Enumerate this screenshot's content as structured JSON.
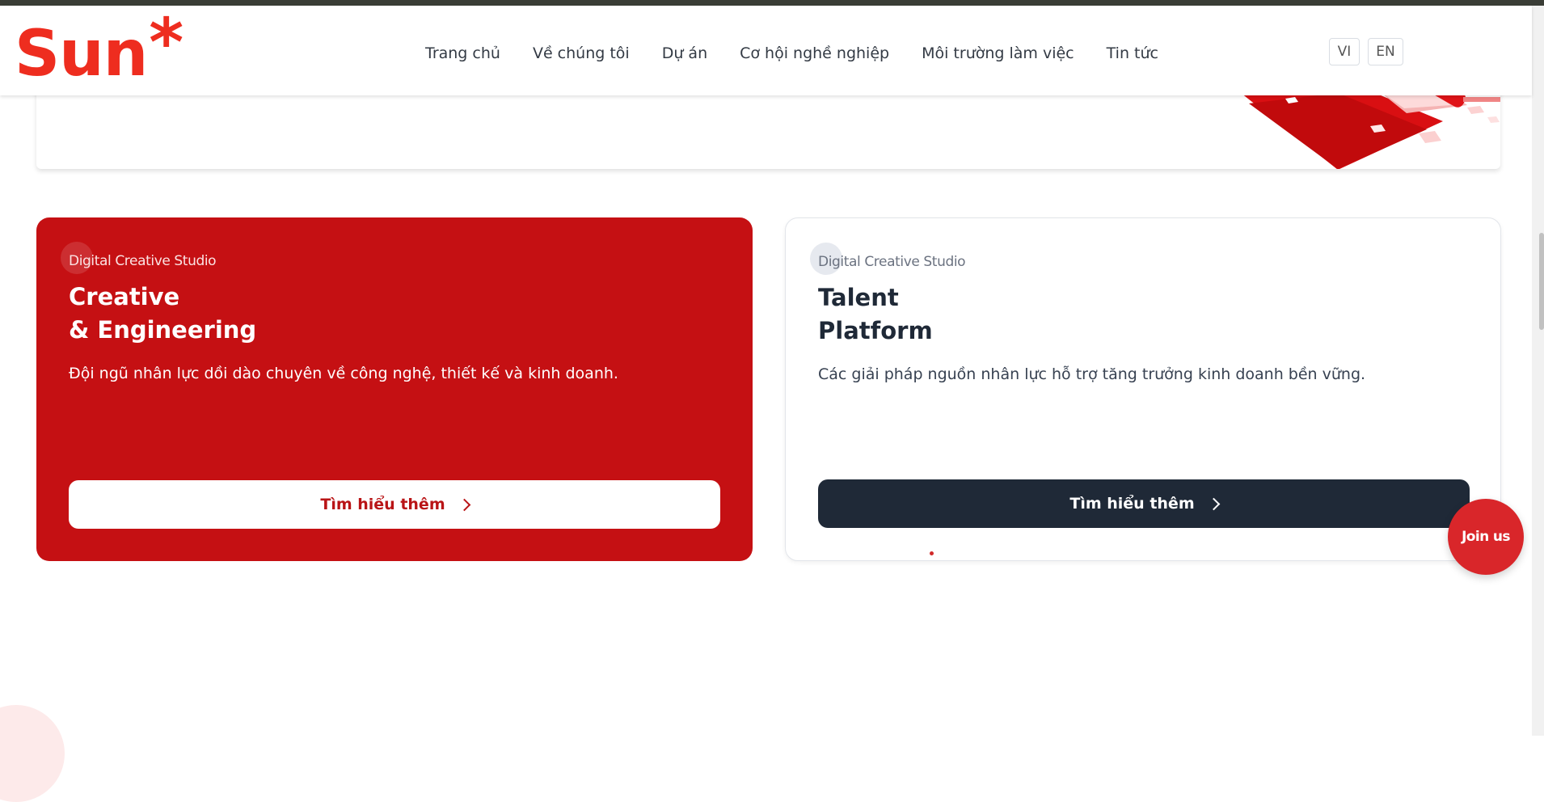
{
  "header": {
    "logo_text": "Sun",
    "logo_star": "*",
    "nav": [
      {
        "label": "Trang chủ"
      },
      {
        "label": "Về chúng tôi"
      },
      {
        "label": "Dự án"
      },
      {
        "label": "Cơ hội nghề nghiệp"
      },
      {
        "label": "Môi trường làm việc"
      },
      {
        "label": "Tin tức"
      }
    ],
    "lang": {
      "vi": "VI",
      "en": "EN"
    }
  },
  "cards": [
    {
      "eyebrow": "Digital Creative Studio",
      "title_line1": "Creative",
      "title_line2": "& Engineering",
      "description": "Đội ngũ nhân lực dồi dào chuyên về công nghệ, thiết kế và kinh doanh.",
      "button_label": "Tìm hiểu thêm"
    },
    {
      "eyebrow": "Digital Creative Studio",
      "title_line1": "Talent",
      "title_line2": "Platform",
      "description": "Các giải pháp nguồn nhân lực hỗ trợ tăng trưởng kinh doanh bền vững.",
      "button_label": "Tìm hiểu thêm"
    }
  ],
  "floating": {
    "join_us": "Join us"
  },
  "colors": {
    "brand": "#ee2d1f",
    "card_red": "#c51013",
    "dark_button": "#1f2937",
    "join_us": "#d9262a"
  }
}
